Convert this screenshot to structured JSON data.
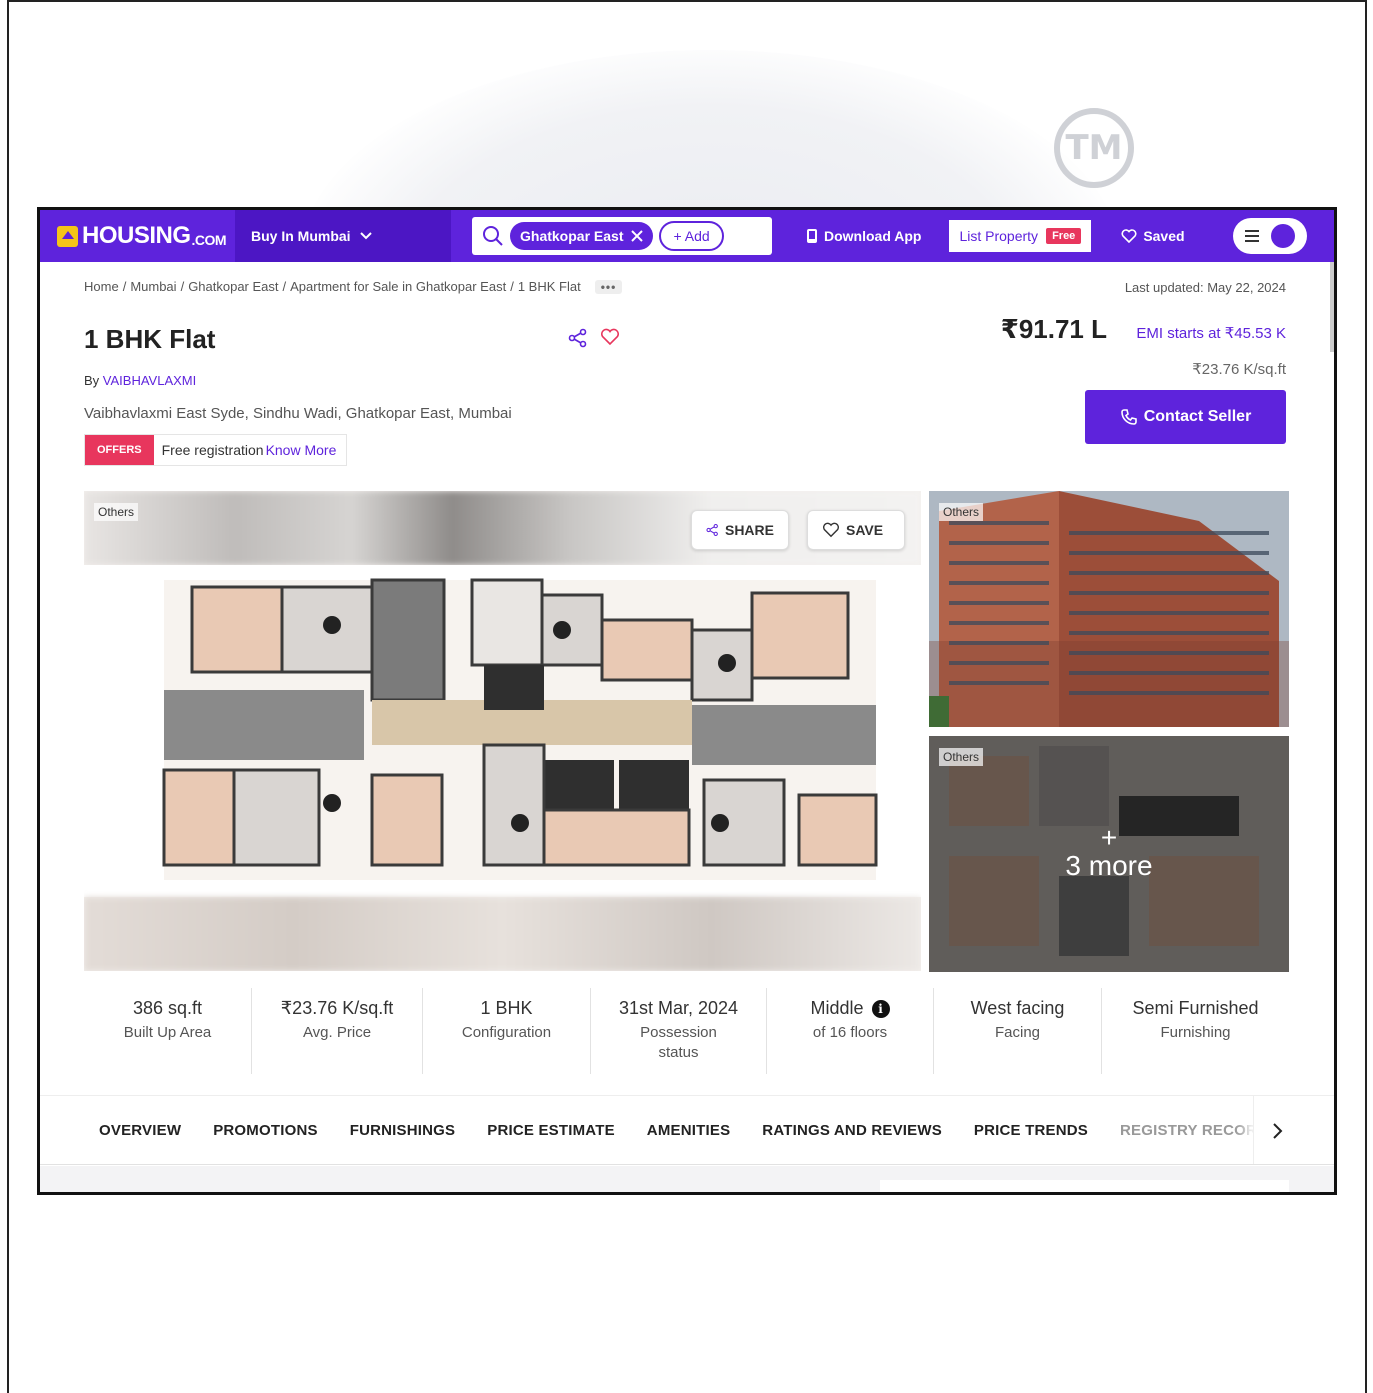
{
  "header": {
    "logo_text": "HOUSING",
    "logo_suffix": ".COM",
    "city_selector": "Buy In Mumbai",
    "search_chip": "Ghatkopar East",
    "add_chip": "+ Add",
    "download_app": "Download App",
    "list_property": "List Property",
    "free_tag": "Free",
    "saved": "Saved"
  },
  "breadcrumb": {
    "items": [
      "Home",
      "Mumbai",
      "Ghatkopar East",
      "Apartment for Sale in Ghatkopar East",
      "1 BHK Flat"
    ],
    "more": "•••"
  },
  "last_updated": "Last updated: May 22, 2024",
  "listing": {
    "title": "1 BHK Flat",
    "by_prefix": "By",
    "developer": "VAIBHAVLAXMI",
    "address": "Vaibhavlaxmi East Syde, Sindhu Wadi, Ghatkopar East, Mumbai",
    "offers_tag": "OFFERS",
    "offers_text": "Free registration",
    "offers_link": "Know More"
  },
  "pricing": {
    "price": "₹91.71 L",
    "emi": "EMI starts at ₹45.53 K",
    "per_sqft": "₹23.76 K/sq.ft",
    "contact_button": "Contact Seller"
  },
  "gallery": {
    "main_tag": "Others",
    "share_label": "SHARE",
    "save_label": "SAVE",
    "side_tag_1": "Others",
    "side_tag_2": "Others",
    "more_plus": "+",
    "more_text": "3 more"
  },
  "stats": [
    {
      "value": "386 sq.ft",
      "label": "Built Up Area"
    },
    {
      "value": "₹23.76 K/sq.ft",
      "label": "Avg. Price"
    },
    {
      "value": "1 BHK",
      "label": "Configuration"
    },
    {
      "value": "31st Mar, 2024",
      "label": "Possession status"
    },
    {
      "value": "Middle",
      "label": "of 16 floors"
    },
    {
      "value": "West facing",
      "label": "Facing"
    },
    {
      "value": "Semi Furnished",
      "label": "Furnishing"
    }
  ],
  "tabs": [
    "OVERVIEW",
    "PROMOTIONS",
    "FURNISHINGS",
    "PRICE ESTIMATE",
    "AMENITIES",
    "RATINGS AND REVIEWS",
    "PRICE TRENDS",
    "REGISTRY RECORDS"
  ],
  "watermark": {
    "tm": "TM"
  },
  "colors": {
    "brand": "#5e23dc",
    "offer": "#e8365d"
  }
}
